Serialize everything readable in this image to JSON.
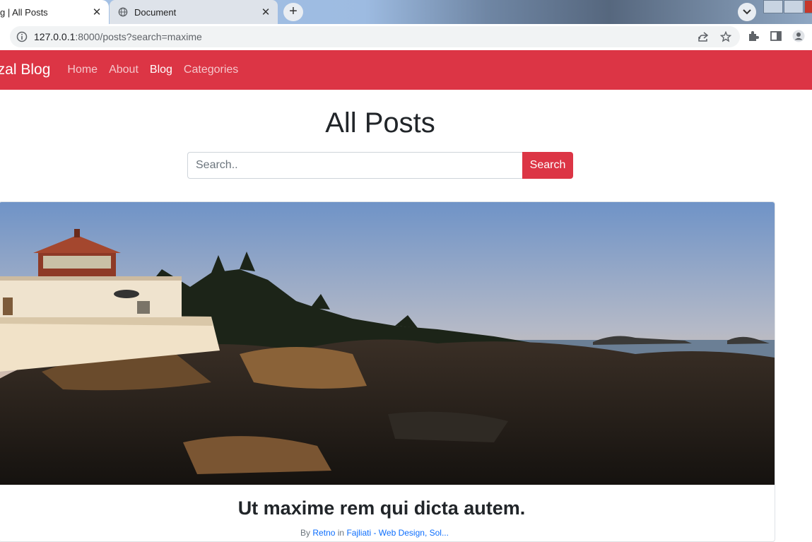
{
  "browser": {
    "tabs": [
      {
        "title": "g | All Posts",
        "active": true
      },
      {
        "title": "Document",
        "active": false
      }
    ],
    "new_tab_label": "+",
    "close_glyph": "✕",
    "url_host": "127.0.0.1",
    "url_rest": ":8000/posts?search=maxime",
    "icons": [
      "info-icon",
      "share-icon",
      "star-icon",
      "extensions-icon",
      "side-panel-icon",
      "profile-icon"
    ]
  },
  "navbar": {
    "brand": "izal Blog",
    "links": [
      {
        "label": "Home",
        "active": false
      },
      {
        "label": "About",
        "active": false
      },
      {
        "label": "Blog",
        "active": true
      },
      {
        "label": "Categories",
        "active": false
      }
    ],
    "color": "#dc3545"
  },
  "main": {
    "title": "All Posts",
    "search": {
      "placeholder": "Search..",
      "value": "",
      "button_label": "Search"
    }
  },
  "post": {
    "title": "Ut maxime rem qui dicta autem.",
    "meta_prefix": "By",
    "author": "Retno",
    "meta_in": "in",
    "category": "Fajliati - Web Design, Sol..."
  }
}
